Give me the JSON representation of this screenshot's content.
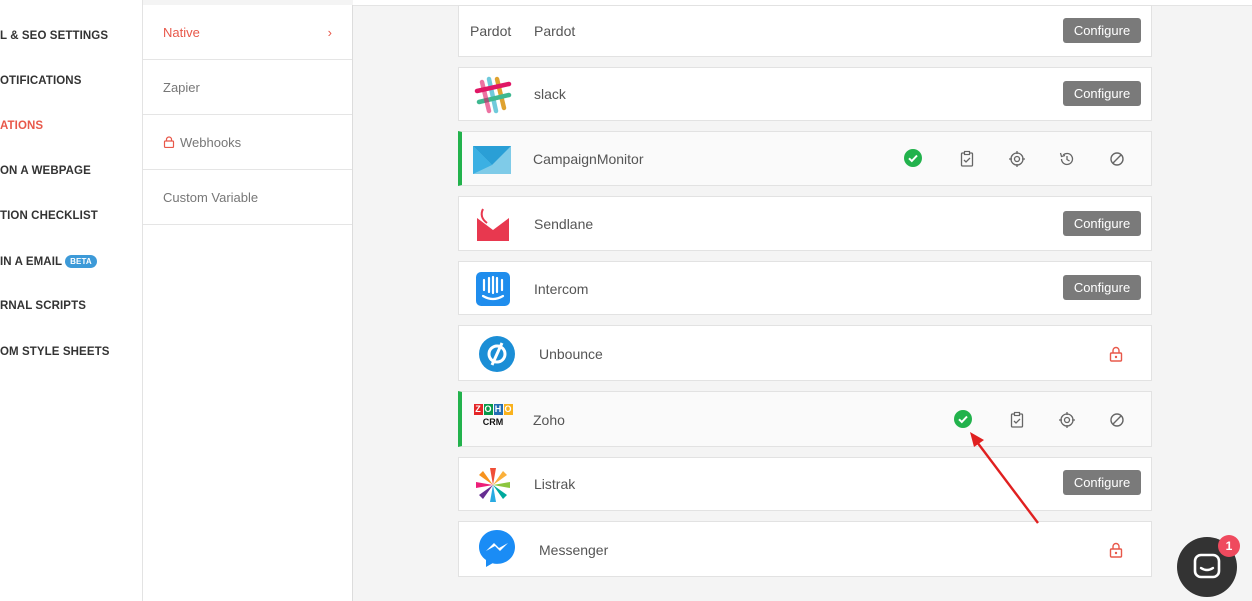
{
  "left_nav": {
    "items": [
      {
        "label": "L & SEO SETTINGS",
        "active": false
      },
      {
        "label": "OTIFICATIONS",
        "active": false
      },
      {
        "label": "ATIONS",
        "active": true
      },
      {
        "label": "ON A WEBPAGE",
        "active": false
      },
      {
        "label": "TION CHECKLIST",
        "active": false
      },
      {
        "label": " IN A EMAIL",
        "active": false,
        "badge": "BETA"
      },
      {
        "label": "RNAL SCRIPTS",
        "active": false
      },
      {
        "label": "OM STYLE SHEETS",
        "active": false
      }
    ]
  },
  "sub_nav": {
    "items": [
      {
        "label": "Native",
        "active": true,
        "chevron": "›"
      },
      {
        "label": "Zapier"
      },
      {
        "label": "Webhooks",
        "icon": "lock-icon"
      },
      {
        "label": "Custom Variable"
      }
    ]
  },
  "integrations": [
    {
      "name": "Pardot",
      "prefix": "Pardot",
      "action": "Configure"
    },
    {
      "name": "slack",
      "logo": "slack-logo",
      "action": "Configure"
    },
    {
      "name": "CampaignMonitor",
      "logo": "campaignmonitor-logo",
      "connected": true
    },
    {
      "name": "Sendlane",
      "logo": "sendlane-logo",
      "action": "Configure"
    },
    {
      "name": "Intercom",
      "logo": "intercom-logo",
      "action": "Configure"
    },
    {
      "name": "Unbounce",
      "logo": "unbounce-logo",
      "locked": true
    },
    {
      "name": "Zoho",
      "logo": "zoho-crm-logo",
      "logo_text": [
        "Z",
        "O",
        "H",
        "O",
        "CRM"
      ],
      "connected": true
    },
    {
      "name": "Listrak",
      "logo": "listrak-logo",
      "action": "Configure"
    },
    {
      "name": "Messenger",
      "logo": "messenger-logo",
      "locked": true
    }
  ],
  "status_icons": [
    "check-circle-icon",
    "clipboard-check-icon",
    "target-icon",
    "history-icon",
    "disable-icon"
  ],
  "chat": {
    "badge": "1"
  },
  "colors": {
    "accent": "#e8584a",
    "connected": "#22b24c",
    "button": "#7a7a7a",
    "badge": "#3d9ad8",
    "chat_badge": "#ef4a5e",
    "annotation_arrow": "#e02020"
  }
}
